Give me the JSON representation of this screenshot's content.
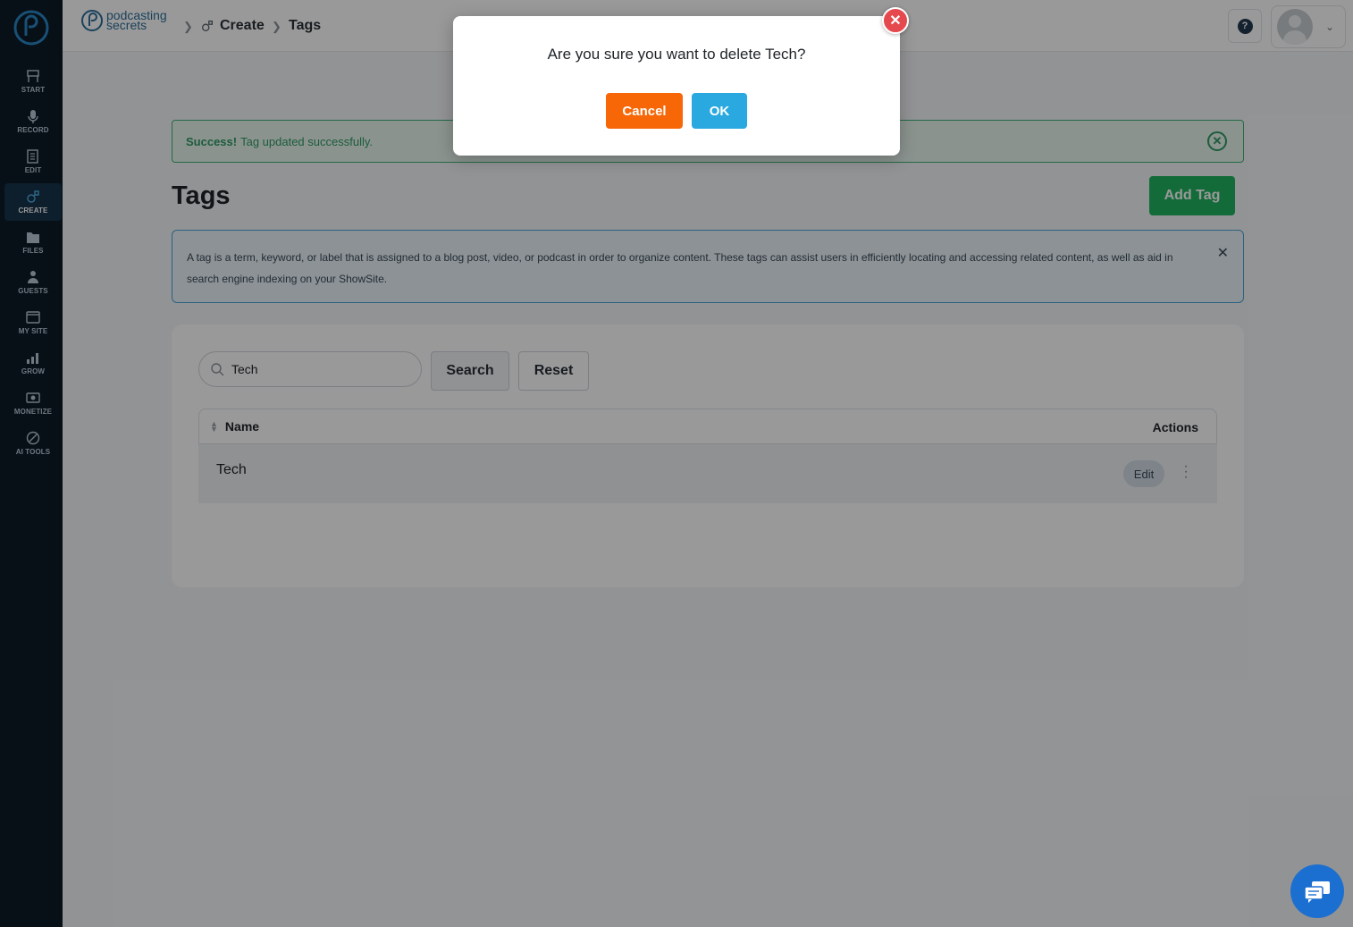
{
  "sidebar": {
    "items": [
      {
        "label": "START",
        "icon": "start-icon"
      },
      {
        "label": "RECORD",
        "icon": "microphone-icon"
      },
      {
        "label": "EDIT",
        "icon": "edit-icon"
      },
      {
        "label": "CREATE",
        "icon": "create-icon",
        "active": true
      },
      {
        "label": "FILES",
        "icon": "files-icon"
      },
      {
        "label": "GUESTS",
        "icon": "guests-icon"
      },
      {
        "label": "MY SITE",
        "icon": "mysite-icon"
      },
      {
        "label": "GROW",
        "icon": "grow-icon"
      },
      {
        "label": "MONETIZE",
        "icon": "monetize-icon"
      },
      {
        "label": "AI TOOLS",
        "icon": "aitools-icon"
      }
    ]
  },
  "header": {
    "brand_line1": "podcasting",
    "brand_line2": "secrets",
    "breadcrumb": [
      "Create",
      "Tags"
    ]
  },
  "alert": {
    "strong": "Success!",
    "message": "Tag updated successfully."
  },
  "page": {
    "title": "Tags",
    "add_button": "Add Tag",
    "info_text": "A tag is a term, keyword, or label that is assigned to a blog post, video, or podcast in order to organize content. These tags can assist users in efficiently locating and accessing related content, as well as aid in search engine indexing on your ShowSite."
  },
  "search": {
    "value": "Tech",
    "search_label": "Search",
    "reset_label": "Reset"
  },
  "table": {
    "columns": [
      "Name",
      "Actions"
    ],
    "rows": [
      {
        "name": "Tech",
        "edit_label": "Edit"
      }
    ]
  },
  "modal": {
    "question": "Are you sure you want to delete Tech?",
    "cancel_label": "Cancel",
    "ok_label": "OK"
  },
  "colors": {
    "sidebar_bg": "#0d1a27",
    "accent_green": "#20b35f",
    "cancel_orange": "#f76707",
    "ok_blue": "#29a9e0",
    "close_red": "#e5484d"
  }
}
